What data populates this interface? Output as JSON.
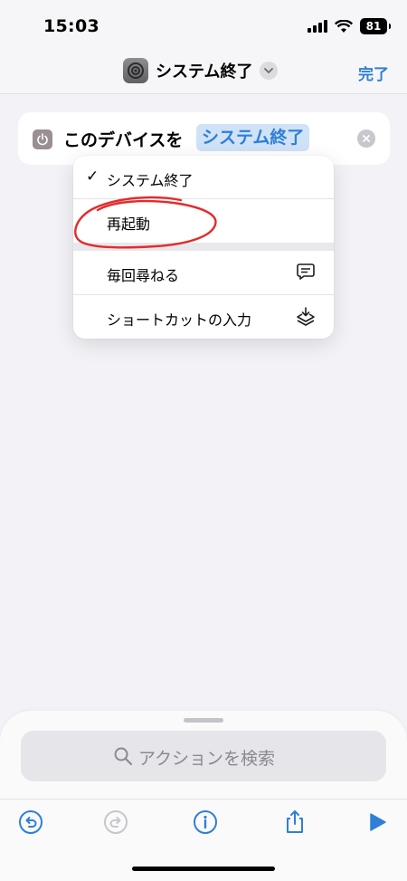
{
  "status_bar": {
    "time": "15:03",
    "battery": "81"
  },
  "nav": {
    "title": "システム終了",
    "done_label": "完了"
  },
  "action": {
    "text": "このデバイスを",
    "parameter": "システム終了"
  },
  "menu": {
    "items": [
      {
        "label": "システム終了",
        "checked": true
      },
      {
        "label": "再起動"
      },
      {
        "label": "毎回尋ねる",
        "icon": "speech-bubble-icon"
      },
      {
        "label": "ショートカットの入力",
        "icon": "layers-download-icon"
      }
    ]
  },
  "search": {
    "placeholder": "アクションを検索"
  },
  "toolbar": {
    "buttons": [
      "undo-icon",
      "redo-icon",
      "info-icon",
      "share-icon",
      "play-icon"
    ]
  },
  "colors": {
    "accent": "#2f7fd6",
    "annotation": "#e52b2b",
    "background": "#f2f2f7"
  }
}
